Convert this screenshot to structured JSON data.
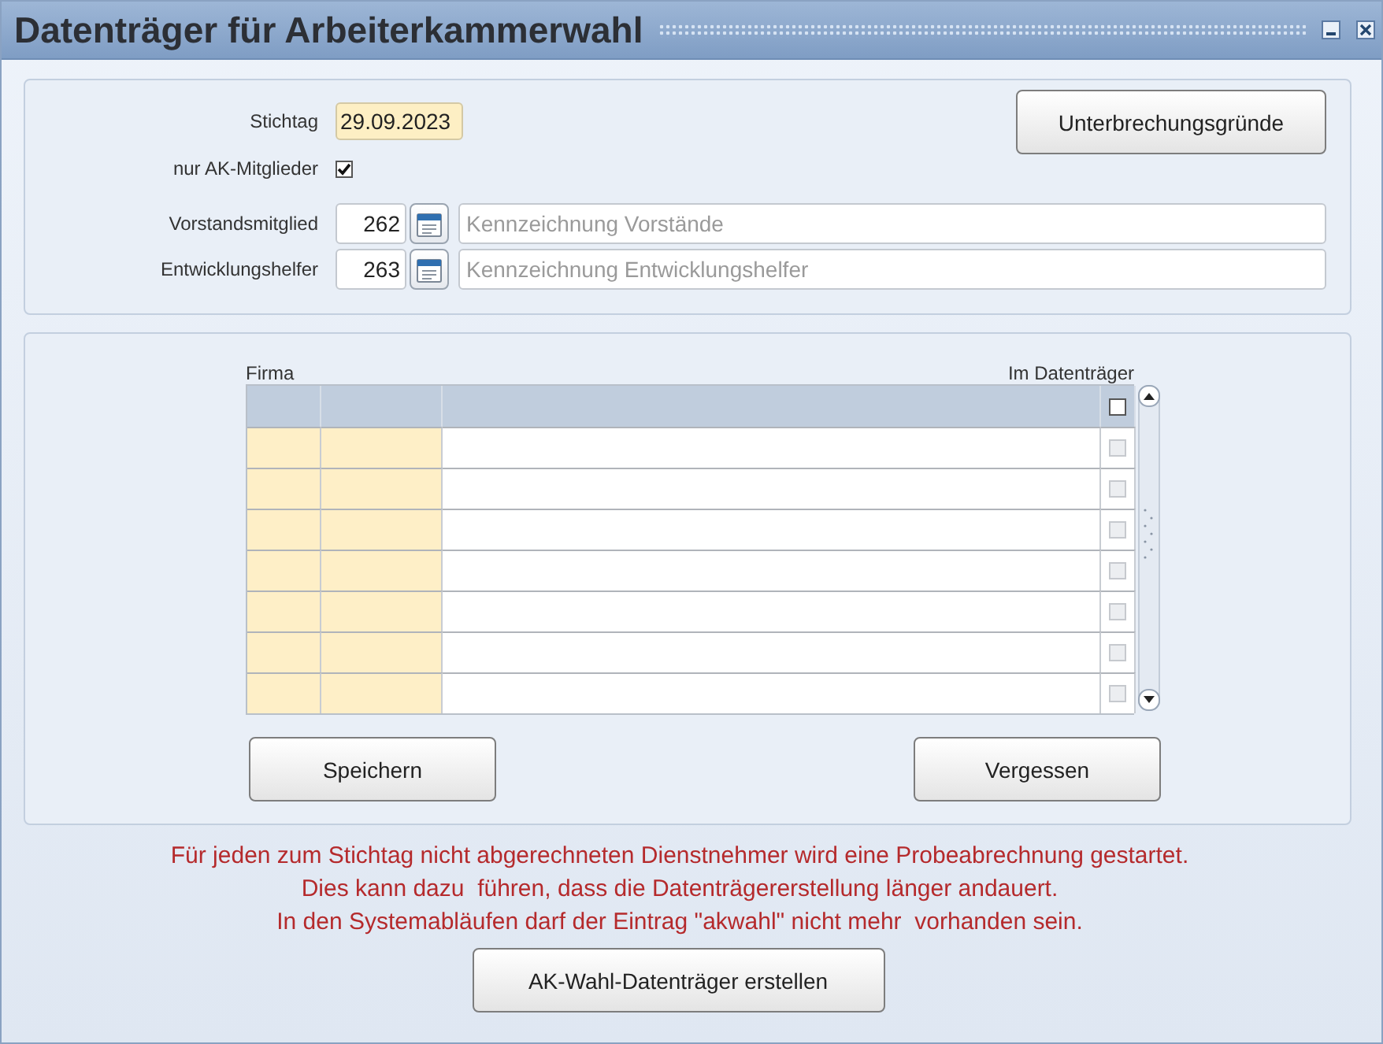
{
  "window": {
    "title": "Datenträger für Arbeiterkammerwahl"
  },
  "criteria": {
    "stichtag": {
      "label": "Stichtag",
      "value": "29.09.2023"
    },
    "members_only": {
      "label": "nur AK-Mitglieder",
      "checked": true
    },
    "lookups": [
      {
        "label": "Vorstandsmitglied",
        "value": "262",
        "placeholder": "Kennzeichnung Vorstände"
      },
      {
        "label": "Entwicklungshelfer",
        "value": "263",
        "placeholder": "Kennzeichnung Entwicklungshelfer"
      }
    ],
    "button": "Unterbrechungsgründe"
  },
  "table": {
    "caption_left": "Firma",
    "caption_right": "Im Datenträger",
    "header_checked": false,
    "rows": [
      {
        "checked": false,
        "disabled": true
      },
      {
        "checked": false,
        "disabled": true
      },
      {
        "checked": false,
        "disabled": true
      },
      {
        "checked": false,
        "disabled": true
      },
      {
        "checked": false,
        "disabled": true
      },
      {
        "checked": false,
        "disabled": true
      },
      {
        "checked": false,
        "disabled": true
      }
    ],
    "buttons": [
      "Speichern",
      "Vergessen"
    ]
  },
  "notice": [
    "Für jeden zum Stichtag nicht abgerechneten Dienstnehmer wird eine Probeabrechnung gestartet.",
    "Dies kann dazu  führen, dass die Datenträgererstellung länger andauert.",
    "In den Systemabläufen darf der Eintrag \"akwahl\" nicht mehr  vorhanden sein."
  ],
  "create_button": "AK-Wahl-Datenträger erstellen"
}
